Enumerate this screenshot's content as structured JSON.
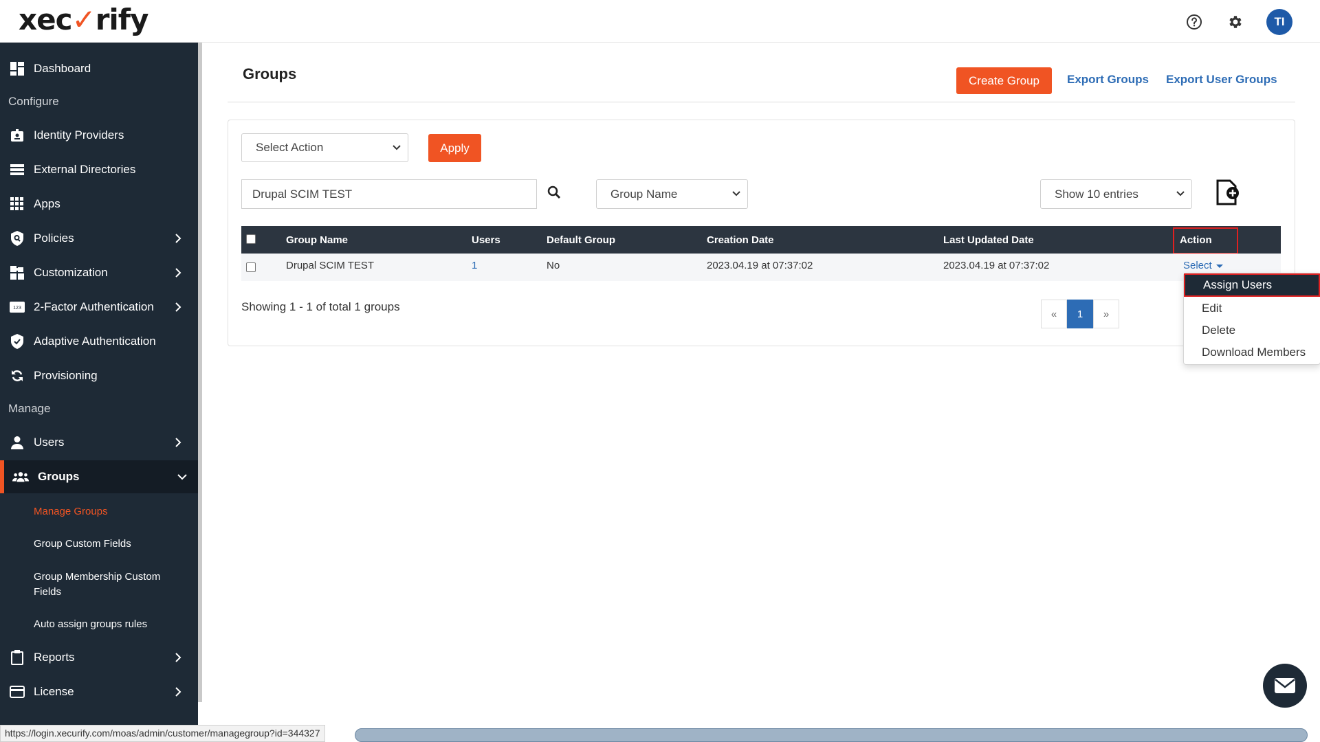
{
  "brand": {
    "logo_text_left": "xec",
    "logo_text_right": "rify"
  },
  "topbar": {
    "avatar_initials": "TI"
  },
  "sidebar": {
    "items": [
      {
        "label": "Dashboard",
        "icon": "dashboard-icon"
      },
      {
        "section": "Configure"
      },
      {
        "label": "Identity Providers",
        "icon": "id-badge-icon"
      },
      {
        "label": "External Directories",
        "icon": "list-icon"
      },
      {
        "label": "Apps",
        "icon": "grid-icon"
      },
      {
        "label": "Policies",
        "icon": "shield-search-icon"
      },
      {
        "label": "Customization",
        "icon": "puzzle-icon"
      },
      {
        "label": "2-Factor Authentication",
        "icon": "123-icon"
      },
      {
        "label": "Adaptive Authentication",
        "icon": "shield-check-icon"
      },
      {
        "label": "Provisioning",
        "icon": "sync-icon"
      },
      {
        "section": "Manage"
      },
      {
        "label": "Users",
        "icon": "user-icon"
      },
      {
        "label": "Groups",
        "icon": "users-icon"
      },
      {
        "label": "Reports",
        "icon": "clipboard-icon"
      },
      {
        "label": "License",
        "icon": "card-icon"
      }
    ],
    "groups_submenu": [
      "Manage Groups",
      "Group Custom Fields",
      "Group Membership Custom Fields",
      "Auto assign groups rules"
    ]
  },
  "page": {
    "title": "Groups",
    "create_button": "Create Group",
    "export_groups": "Export Groups",
    "export_user_groups": "Export User Groups"
  },
  "filters": {
    "bulk_action": "Select Action",
    "apply": "Apply",
    "search_value": "Drupal SCIM TEST",
    "search_by": "Group Name",
    "page_size": "Show 10 entries"
  },
  "table": {
    "headers": [
      "Group Name",
      "Users",
      "Default Group",
      "Creation Date",
      "Last Updated Date",
      "Action"
    ],
    "rows": [
      {
        "group_name": "Drupal SCIM TEST",
        "users": "1",
        "default_group": "No",
        "created": "2023.04.19 at 07:37:02",
        "updated": "2023.04.19 at 07:37:02",
        "action": "Select"
      }
    ]
  },
  "action_menu": [
    "Assign Users",
    "Edit",
    "Delete",
    "Download Members"
  ],
  "summary": "Showing 1 - 1 of total 1 groups",
  "pagination": {
    "prev": "«",
    "current": "1",
    "next": "»"
  },
  "status_bar": {
    "url": "https://login.xecurify.com/moas/admin/customer/managegroup?id=344327"
  },
  "colors": {
    "accent": "#f05423",
    "sidebar": "#1e2a36",
    "link": "#2d6cb5"
  }
}
